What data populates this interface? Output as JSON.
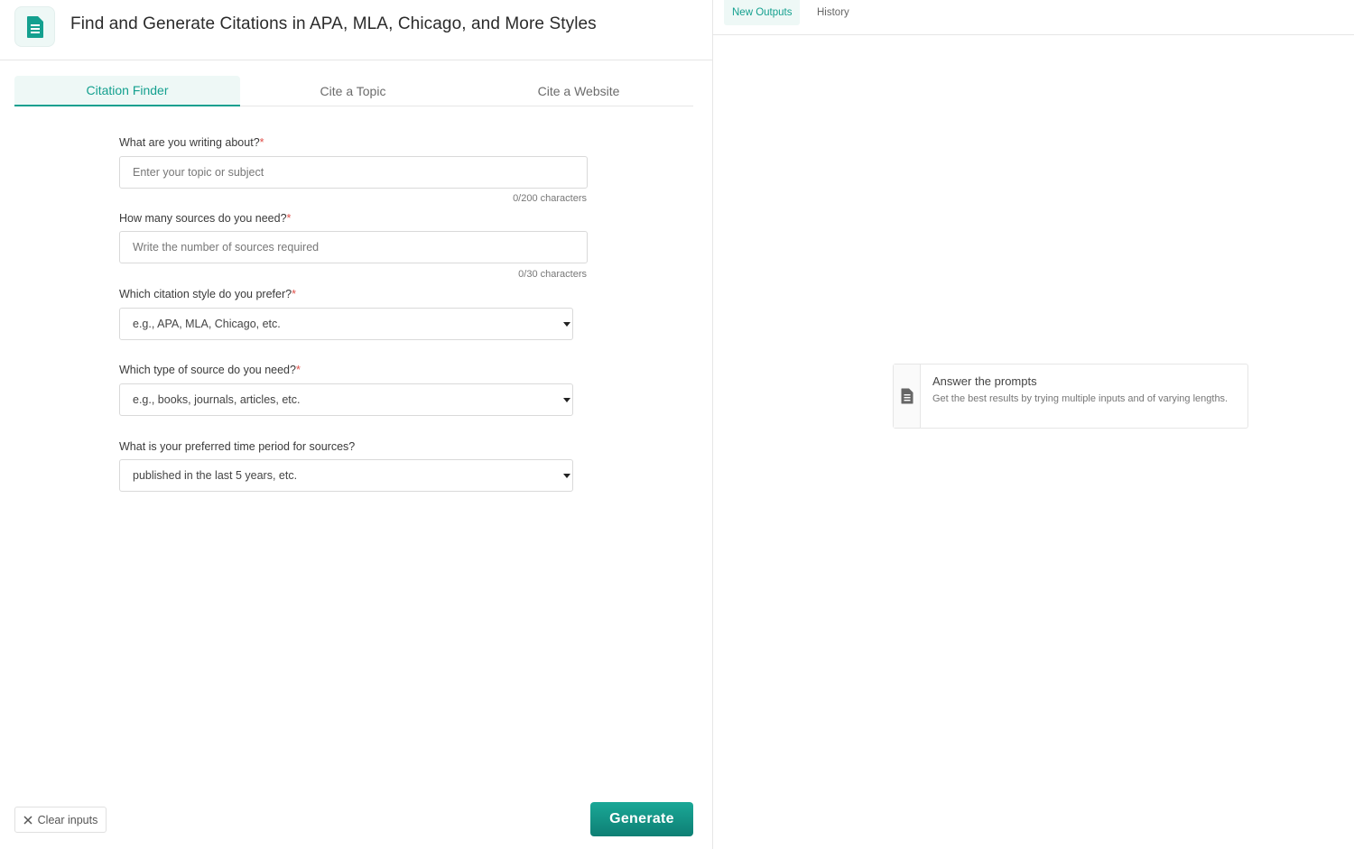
{
  "header": {
    "title": "Find and Generate Citations in APA, MLA, Chicago, and More Styles",
    "icon": "document-icon",
    "accent": "#14a08f"
  },
  "tabs": [
    {
      "label": "Citation Finder",
      "active": true
    },
    {
      "label": "Cite a Topic",
      "active": false
    },
    {
      "label": "Cite a Website",
      "active": false
    }
  ],
  "form": {
    "topic": {
      "label": "What are you writing about?",
      "required_mark": "*",
      "placeholder": "Enter your topic or subject",
      "value": "",
      "counter": "0/200 characters"
    },
    "sources": {
      "label": "How many sources do you need?",
      "required_mark": "*",
      "placeholder": "Write the number of sources required",
      "value": "",
      "counter": "0/30 characters"
    },
    "style": {
      "label": "Which citation style do you prefer?",
      "required_mark": "*",
      "selected": "e.g., APA, MLA, Chicago, etc."
    },
    "source_type": {
      "label": "Which type of source do you need?",
      "required_mark": "*",
      "selected": "e.g., books, journals, articles, etc."
    },
    "time_period": {
      "label": "What is your preferred time period for sources?",
      "selected": "published in the last 5 years, etc."
    }
  },
  "footer": {
    "clear_label": "Clear inputs",
    "generate_label": "Generate"
  },
  "output": {
    "tabs": [
      {
        "label": "New Outputs",
        "active": true
      },
      {
        "label": "History",
        "active": false
      }
    ],
    "hint_title": "Answer the prompts",
    "hint_desc": "Get the best results by trying multiple inputs and of varying lengths.",
    "hint_icon": "document-icon"
  }
}
